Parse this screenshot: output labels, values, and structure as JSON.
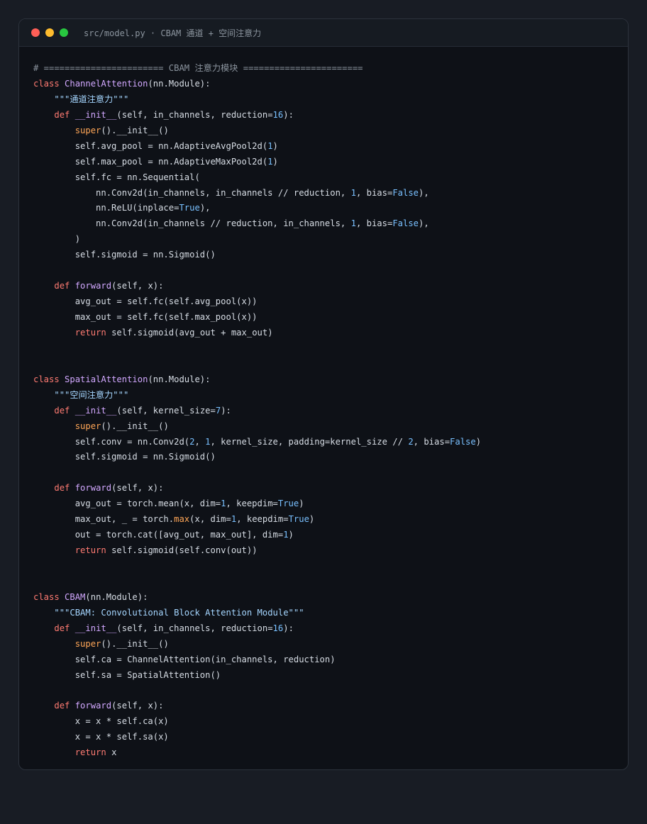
{
  "window": {
    "title": "src/model.py · CBAM 通道 + 空间注意力",
    "controls": {
      "close_color": "#ff5f57",
      "minimize_color": "#febc2e",
      "zoom_color": "#28c840"
    }
  },
  "code": {
    "language": "python",
    "lines": [
      [
        [
          "com",
          "# ======================= CBAM 注意力模块 ======================="
        ]
      ],
      [
        [
          "kw",
          "class "
        ],
        [
          "cls",
          "ChannelAttention"
        ],
        [
          "",
          "(nn.Module):"
        ]
      ],
      [
        [
          "",
          "    "
        ],
        [
          "str",
          "\"\"\"通道注意力\"\"\""
        ]
      ],
      [
        [
          "",
          "    "
        ],
        [
          "kw",
          "def "
        ],
        [
          "fn",
          "__init__"
        ],
        [
          "",
          "(self, in_channels, reduction="
        ],
        [
          "num",
          "16"
        ],
        [
          "",
          "):"
        ]
      ],
      [
        [
          "",
          "        "
        ],
        [
          "bi",
          "super"
        ],
        [
          "",
          "().__init__()"
        ]
      ],
      [
        [
          "",
          "        self.avg_pool = nn.AdaptiveAvgPool2d("
        ],
        [
          "num",
          "1"
        ],
        [
          "",
          ")"
        ]
      ],
      [
        [
          "",
          "        self.max_pool = nn.AdaptiveMaxPool2d("
        ],
        [
          "num",
          "1"
        ],
        [
          "",
          ")"
        ]
      ],
      [
        [
          "",
          "        self.fc = nn.Sequential("
        ]
      ],
      [
        [
          "",
          "            nn.Conv2d(in_channels, in_channels // reduction, "
        ],
        [
          "num",
          "1"
        ],
        [
          "",
          ", bias="
        ],
        [
          "bool",
          "False"
        ],
        [
          "",
          "),"
        ]
      ],
      [
        [
          "",
          "            nn.ReLU(inplace="
        ],
        [
          "bool",
          "True"
        ],
        [
          "",
          "),"
        ]
      ],
      [
        [
          "",
          "            nn.Conv2d(in_channels // reduction, in_channels, "
        ],
        [
          "num",
          "1"
        ],
        [
          "",
          ", bias="
        ],
        [
          "bool",
          "False"
        ],
        [
          "",
          "),"
        ]
      ],
      [
        [
          "",
          "        )"
        ]
      ],
      [
        [
          "",
          "        self.sigmoid = nn.Sigmoid()"
        ]
      ],
      [
        [
          "",
          ""
        ]
      ],
      [
        [
          "",
          "    "
        ],
        [
          "kw",
          "def "
        ],
        [
          "fn",
          "forward"
        ],
        [
          "",
          "(self, x):"
        ]
      ],
      [
        [
          "",
          "        avg_out = self.fc(self.avg_pool(x))"
        ]
      ],
      [
        [
          "",
          "        max_out = self.fc(self.max_pool(x))"
        ]
      ],
      [
        [
          "",
          "        "
        ],
        [
          "kw",
          "return "
        ],
        [
          "",
          "self.sigmoid(avg_out + max_out)"
        ]
      ],
      [
        [
          "",
          ""
        ]
      ],
      [
        [
          "",
          ""
        ]
      ],
      [
        [
          "kw",
          "class "
        ],
        [
          "cls",
          "SpatialAttention"
        ],
        [
          "",
          "(nn.Module):"
        ]
      ],
      [
        [
          "",
          "    "
        ],
        [
          "str",
          "\"\"\"空间注意力\"\"\""
        ]
      ],
      [
        [
          "",
          "    "
        ],
        [
          "kw",
          "def "
        ],
        [
          "fn",
          "__init__"
        ],
        [
          "",
          "(self, kernel_size="
        ],
        [
          "num",
          "7"
        ],
        [
          "",
          "):"
        ]
      ],
      [
        [
          "",
          "        "
        ],
        [
          "bi",
          "super"
        ],
        [
          "",
          "().__init__()"
        ]
      ],
      [
        [
          "",
          "        self.conv = nn.Conv2d("
        ],
        [
          "num",
          "2"
        ],
        [
          "",
          ", "
        ],
        [
          "num",
          "1"
        ],
        [
          "",
          ", kernel_size, padding=kernel_size // "
        ],
        [
          "num",
          "2"
        ],
        [
          "",
          ", bias="
        ],
        [
          "bool",
          "False"
        ],
        [
          "",
          ")"
        ]
      ],
      [
        [
          "",
          "        self.sigmoid = nn.Sigmoid()"
        ]
      ],
      [
        [
          "",
          ""
        ]
      ],
      [
        [
          "",
          "    "
        ],
        [
          "kw",
          "def "
        ],
        [
          "fn",
          "forward"
        ],
        [
          "",
          "(self, x):"
        ]
      ],
      [
        [
          "",
          "        avg_out = torch.mean(x, dim="
        ],
        [
          "num",
          "1"
        ],
        [
          "",
          ", keepdim="
        ],
        [
          "bool",
          "True"
        ],
        [
          "",
          ")"
        ]
      ],
      [
        [
          "",
          "        max_out, _ = torch."
        ],
        [
          "bi",
          "max"
        ],
        [
          "",
          "(x, dim="
        ],
        [
          "num",
          "1"
        ],
        [
          "",
          ", keepdim="
        ],
        [
          "bool",
          "True"
        ],
        [
          "",
          ")"
        ]
      ],
      [
        [
          "",
          "        out = torch.cat([avg_out, max_out], dim="
        ],
        [
          "num",
          "1"
        ],
        [
          "",
          ")"
        ]
      ],
      [
        [
          "",
          "        "
        ],
        [
          "kw",
          "return "
        ],
        [
          "",
          "self.sigmoid(self.conv(out))"
        ]
      ],
      [
        [
          "",
          ""
        ]
      ],
      [
        [
          "",
          ""
        ]
      ],
      [
        [
          "kw",
          "class "
        ],
        [
          "cls",
          "CBAM"
        ],
        [
          "",
          "(nn.Module):"
        ]
      ],
      [
        [
          "",
          "    "
        ],
        [
          "str",
          "\"\"\"CBAM: Convolutional Block Attention Module\"\"\""
        ]
      ],
      [
        [
          "",
          "    "
        ],
        [
          "kw",
          "def "
        ],
        [
          "fn",
          "__init__"
        ],
        [
          "",
          "(self, in_channels, reduction="
        ],
        [
          "num",
          "16"
        ],
        [
          "",
          "):"
        ]
      ],
      [
        [
          "",
          "        "
        ],
        [
          "bi",
          "super"
        ],
        [
          "",
          "().__init__()"
        ]
      ],
      [
        [
          "",
          "        self.ca = ChannelAttention(in_channels, reduction)"
        ]
      ],
      [
        [
          "",
          "        self.sa = SpatialAttention()"
        ]
      ],
      [
        [
          "",
          ""
        ]
      ],
      [
        [
          "",
          "    "
        ],
        [
          "kw",
          "def "
        ],
        [
          "fn",
          "forward"
        ],
        [
          "",
          "(self, x):"
        ]
      ],
      [
        [
          "",
          "        x = x * self.ca(x)"
        ]
      ],
      [
        [
          "",
          "        x = x * self.sa(x)"
        ]
      ],
      [
        [
          "",
          "        "
        ],
        [
          "kw",
          "return "
        ],
        [
          "",
          "x"
        ]
      ]
    ]
  }
}
